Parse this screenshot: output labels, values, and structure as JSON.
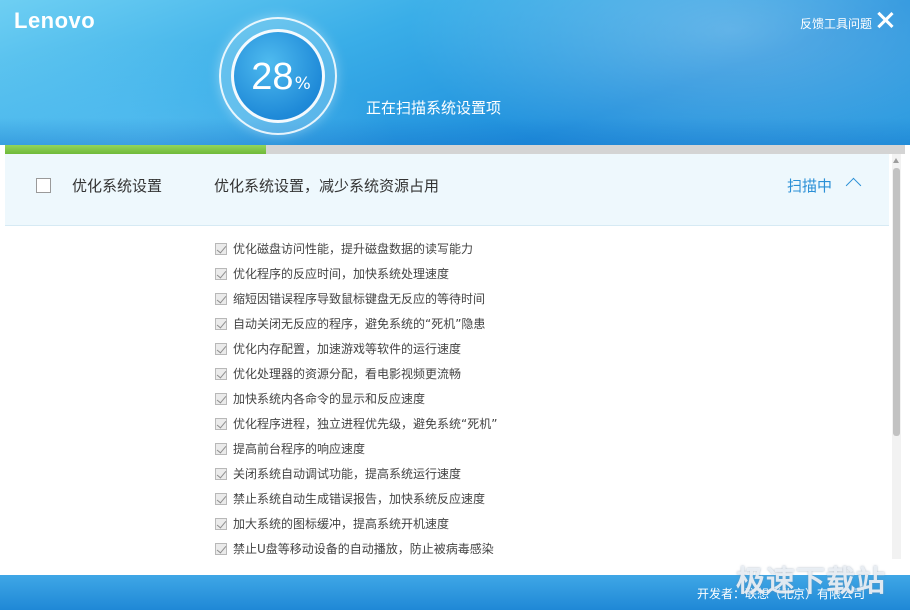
{
  "header": {
    "logo": "Lenovo",
    "feedback_label": "反馈工具问题",
    "progress_percent": 28,
    "progress_sign": "%",
    "status_text": "正在扫描系统设置项"
  },
  "scan_progress": 0.29,
  "section": {
    "title": "优化系统设置",
    "description": "优化系统设置，减少系统资源占用",
    "status": "扫描中"
  },
  "items": [
    "优化磁盘访问性能，提升磁盘数据的读写能力",
    "优化程序的反应时间，加快系统处理速度",
    "缩短因错误程序导致鼠标键盘无反应的等待时间",
    "自动关闭无反应的程序，避免系统的“死机”隐患",
    "优化内存配置，加速游戏等软件的运行速度",
    "优化处理器的资源分配，看电影视频更流畅",
    "加快系统内各命令的显示和反应速度",
    "优化程序进程，独立进程优先级，避免系统“死机”",
    "提高前台程序的响应速度",
    "关闭系统自动调试功能，提高系统运行速度",
    "禁止系统自动生成错误报告，加快系统反应速度",
    "加大系统的图标缓冲，提高系统开机速度",
    "禁止U盘等移动设备的自动播放，防止被病毒感染"
  ],
  "footer": {
    "developer": "开发者：联想（北京）有限公司"
  },
  "watermark": "极速下载站",
  "colors": {
    "accent": "#2a8fd6",
    "progress": "#7cc243",
    "header": "#1f8fdc"
  }
}
